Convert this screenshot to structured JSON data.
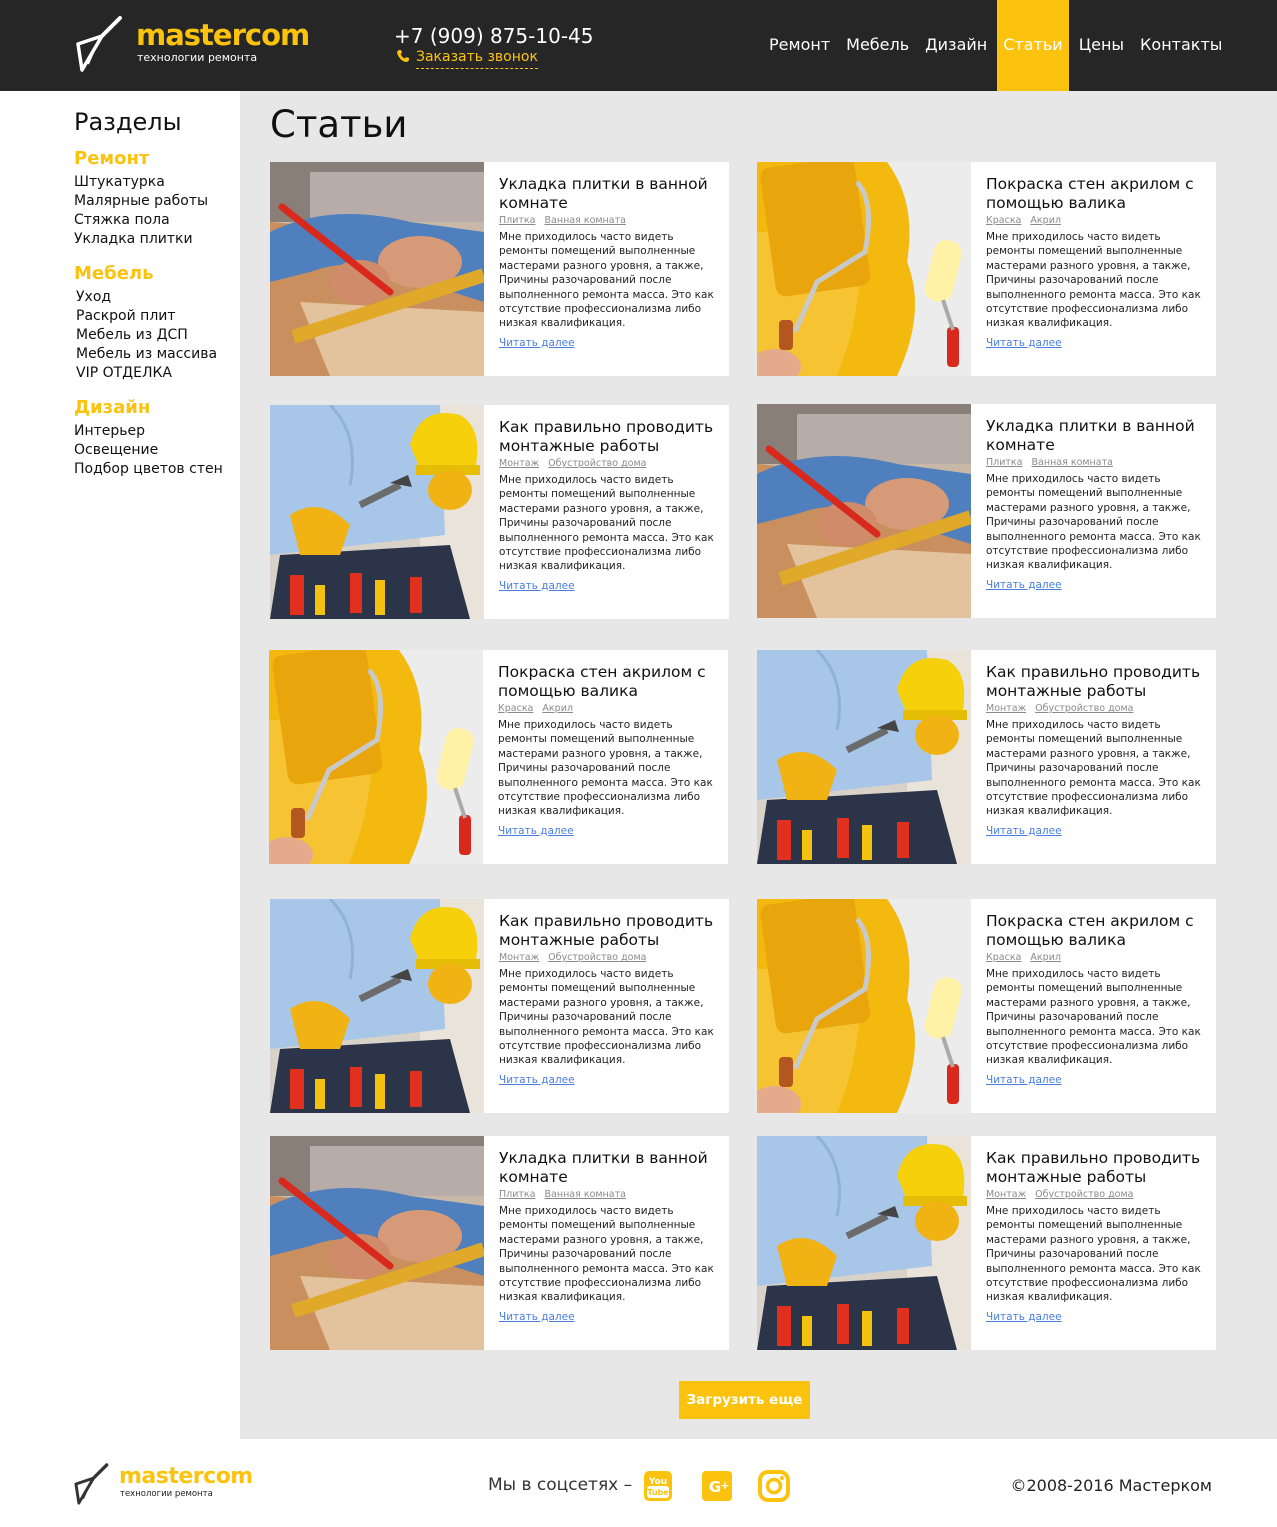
{
  "brand": {
    "name": "mastercom",
    "tagline": "технологии ремонта",
    "accent": "#fcc30e",
    "header_bg": "#262626",
    "content_bg": "#e7e7e7"
  },
  "header": {
    "phone": "+7 (909) 875-10-45",
    "callback": "Заказать звонок",
    "nav": [
      "Ремонт",
      "Мебель",
      "Дизайн",
      "Статьи",
      "Цены",
      "Контакты"
    ],
    "active_nav": "Статьи"
  },
  "sidebar": {
    "title": "Разделы",
    "groups": [
      {
        "title": "Ремонт",
        "links": [
          "Штукатурка",
          "Малярные работы",
          "Стяжка пола",
          "Укладка плитки"
        ]
      },
      {
        "title": "Мебель",
        "links": [
          "Уход",
          "Раскрой плит",
          "Мебель из ДСП",
          "Мебель из массива",
          "VIP ОТДЕЛКА"
        ]
      },
      {
        "title": "Дизайн",
        "links": [
          "Интерьер",
          "Освещение",
          "Подбор цветов стен"
        ]
      }
    ]
  },
  "main": {
    "title": "Статьи",
    "read_more": "Читать далее",
    "description": "Мне приходилось часто видеть ремонты помещений выполненные мастерами разного уровня, а также, Причины разочарований после выполненного ремонта масса. Это как отсутствие профессионализма  либо низкая квалификация.",
    "articles": [
      {
        "title": "Укладка плитки в ванной комнате",
        "tags": [
          "Плитка",
          "Ванная комната"
        ],
        "image": "tile-worker"
      },
      {
        "title": "Покраска стен акрилом с помощью валика",
        "tags": [
          "Краска",
          "Акрил"
        ],
        "image": "paint-roller"
      },
      {
        "title": "Как правильно проводить монтажные работы",
        "tags": [
          "Монтаж",
          "Обустройство дома"
        ],
        "image": "builder-helmet"
      },
      {
        "title": "Укладка плитки в ванной комнате",
        "tags": [
          "Плитка",
          "Ванная комната"
        ],
        "image": "tile-worker"
      },
      {
        "title": "Покраска стен акрилом с помощью валика",
        "tags": [
          "Краска",
          "Акрил"
        ],
        "image": "paint-roller"
      },
      {
        "title": "Как правильно проводить монтажные работы",
        "tags": [
          "Монтаж",
          "Обустройство дома"
        ],
        "image": "builder-helmet"
      },
      {
        "title": "Как правильно проводить монтажные работы",
        "tags": [
          "Монтаж",
          "Обустройство дома"
        ],
        "image": "builder-helmet"
      },
      {
        "title": "Покраска стен акрилом с помощью валика",
        "tags": [
          "Краска",
          "Акрил"
        ],
        "image": "paint-roller"
      },
      {
        "title": "Укладка плитки в ванной комнате",
        "tags": [
          "Плитка",
          "Ванная комната"
        ],
        "image": "tile-worker"
      },
      {
        "title": "Как правильно проводить монтажные работы",
        "tags": [
          "Монтаж",
          "Обустройство дома"
        ],
        "image": "builder-helmet"
      }
    ],
    "load_more": "Загрузить еще"
  },
  "footer": {
    "social_label": "Мы в соцсетях –",
    "social": [
      "youtube-icon",
      "google-plus-icon",
      "instagram-icon"
    ],
    "copyright": "©2008-2016 Мастерком"
  }
}
